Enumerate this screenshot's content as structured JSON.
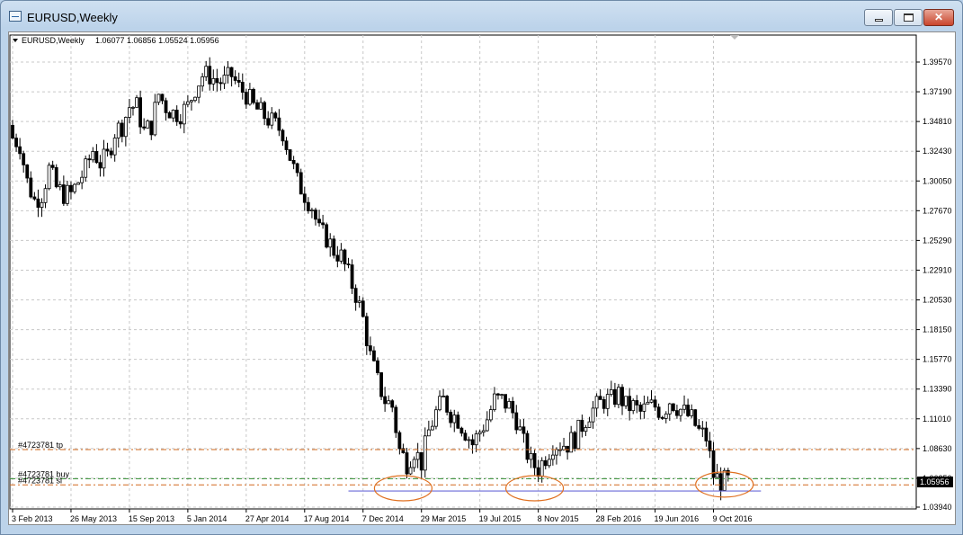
{
  "window": {
    "title": "EURUSD,Weekly",
    "buttons": {
      "minimize": "minimize",
      "maximize": "maximize",
      "close": "close"
    }
  },
  "chart_header": {
    "symbol": "EURUSD,Weekly",
    "ohlc": "1.06077 1.06856 1.05524 1.05956"
  },
  "chart_data": {
    "type": "candlestick",
    "symbol": "EURUSD",
    "timeframe": "Weekly",
    "ylim": [
      1.0394,
      1.4097
    ],
    "y_ticks": [
      "1.39570",
      "1.37190",
      "1.34810",
      "1.32430",
      "1.30050",
      "1.27670",
      "1.25290",
      "1.22910",
      "1.20530",
      "1.18150",
      "1.15770",
      "1.13390",
      "1.11010",
      "1.08630",
      "1.06250",
      "1.03940"
    ],
    "x_ticks": [
      "3 Feb 2013",
      "26 May 2013",
      "15 Sep 2013",
      "5 Jan 2014",
      "27 Apr 2014",
      "17 Aug 2014",
      "7 Dec 2014",
      "29 Mar 2015",
      "19 Jul 2015",
      "8 Nov 2015",
      "28 Feb 2016",
      "19 Jun 2016",
      "9 Oct 2016"
    ],
    "x_tick_index": [
      0,
      16,
      32,
      48,
      64,
      80,
      96,
      112,
      128,
      144,
      160,
      176,
      192
    ],
    "last_price_label": "1.05956",
    "close_path": [
      [
        0,
        1.335
      ],
      [
        2,
        1.33
      ],
      [
        4,
        1.3
      ],
      [
        6,
        1.285
      ],
      [
        8,
        1.29
      ],
      [
        10,
        1.31
      ],
      [
        12,
        1.295
      ],
      [
        14,
        1.29
      ],
      [
        16,
        1.29
      ],
      [
        18,
        1.3
      ],
      [
        20,
        1.31
      ],
      [
        22,
        1.325
      ],
      [
        24,
        1.315
      ],
      [
        26,
        1.32
      ],
      [
        28,
        1.34
      ],
      [
        30,
        1.345
      ],
      [
        32,
        1.36
      ],
      [
        34,
        1.36
      ],
      [
        36,
        1.34
      ],
      [
        38,
        1.345
      ],
      [
        40,
        1.37
      ],
      [
        42,
        1.36
      ],
      [
        44,
        1.355
      ],
      [
        46,
        1.355
      ],
      [
        48,
        1.36
      ],
      [
        50,
        1.375
      ],
      [
        52,
        1.385
      ],
      [
        54,
        1.385
      ],
      [
        56,
        1.38
      ],
      [
        58,
        1.38
      ],
      [
        60,
        1.385
      ],
      [
        62,
        1.375
      ],
      [
        64,
        1.37
      ],
      [
        66,
        1.36
      ],
      [
        68,
        1.355
      ],
      [
        70,
        1.35
      ],
      [
        72,
        1.345
      ],
      [
        74,
        1.34
      ],
      [
        76,
        1.32
      ],
      [
        78,
        1.3
      ],
      [
        80,
        1.29
      ],
      [
        82,
        1.28
      ],
      [
        84,
        1.26
      ],
      [
        86,
        1.255
      ],
      [
        88,
        1.245
      ],
      [
        90,
        1.24
      ],
      [
        92,
        1.225
      ],
      [
        94,
        1.21
      ],
      [
        96,
        1.19
      ],
      [
        98,
        1.16
      ],
      [
        100,
        1.14
      ],
      [
        102,
        1.125
      ],
      [
        104,
        1.12
      ],
      [
        106,
        1.085
      ],
      [
        108,
        1.075
      ],
      [
        110,
        1.085
      ],
      [
        112,
        1.075
      ],
      [
        114,
        1.1
      ],
      [
        116,
        1.115
      ],
      [
        118,
        1.125
      ],
      [
        120,
        1.115
      ],
      [
        122,
        1.11
      ],
      [
        124,
        1.1
      ],
      [
        126,
        1.09
      ],
      [
        128,
        1.1
      ],
      [
        130,
        1.11
      ],
      [
        132,
        1.125
      ],
      [
        134,
        1.125
      ],
      [
        136,
        1.12
      ],
      [
        138,
        1.11
      ],
      [
        140,
        1.09
      ],
      [
        142,
        1.075
      ],
      [
        144,
        1.07
      ],
      [
        146,
        1.08
      ],
      [
        148,
        1.09
      ],
      [
        150,
        1.09
      ],
      [
        152,
        1.09
      ],
      [
        154,
        1.095
      ],
      [
        156,
        1.105
      ],
      [
        158,
        1.115
      ],
      [
        160,
        1.12
      ],
      [
        162,
        1.125
      ],
      [
        164,
        1.125
      ],
      [
        166,
        1.13
      ],
      [
        168,
        1.12
      ],
      [
        170,
        1.12
      ],
      [
        172,
        1.115
      ],
      [
        174,
        1.12
      ],
      [
        176,
        1.12
      ],
      [
        178,
        1.115
      ],
      [
        180,
        1.125
      ],
      [
        182,
        1.12
      ],
      [
        184,
        1.115
      ],
      [
        186,
        1.11
      ],
      [
        188,
        1.1
      ],
      [
        190,
        1.095
      ],
      [
        192,
        1.065
      ],
      [
        194,
        1.06
      ],
      [
        196,
        1.06
      ]
    ],
    "levels": [
      {
        "label": "#4723781 tp",
        "price": 1.0855,
        "color": "#d2691e",
        "style": "dash-dot"
      },
      {
        "label": "#4723781 buy",
        "price": 1.0622,
        "color": "#2e8b2e",
        "style": "dash-dot"
      },
      {
        "label": "#4723781 sl",
        "price": 1.0572,
        "color": "#d2691e",
        "style": "dash-dot"
      }
    ],
    "support_line": {
      "price": 1.0523,
      "x_from": 92,
      "x_to": 205,
      "color": "#6a6ad8"
    },
    "ellipses": [
      {
        "center_index": 107,
        "price": 1.0545,
        "color": "#e07020"
      },
      {
        "center_index": 143,
        "price": 1.0545,
        "color": "#e07020"
      },
      {
        "center_index": 195,
        "price": 1.0575,
        "color": "#e07020"
      }
    ]
  }
}
